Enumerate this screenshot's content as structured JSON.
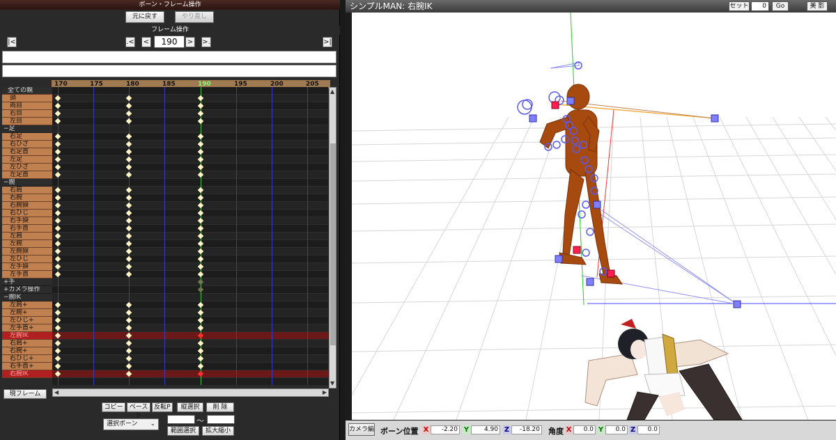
{
  "left_panel": {
    "bone_frame_header": "ボーン・フレーム操作",
    "undo_label": "元に戻す",
    "redo_label": "やり直し",
    "frame_ops_header": "フレーム操作",
    "nav": {
      "first": "|<",
      "prev_key": ".<",
      "prev": "<",
      "next": ">",
      "next_key": ">.",
      "last": ">|"
    },
    "current_frame": "190",
    "ruler": [
      "170",
      "175",
      "180",
      "185",
      "190",
      "195",
      "200",
      "205"
    ],
    "bones": [
      {
        "label": "全ての親",
        "kind": "top"
      },
      {
        "label": "頭",
        "kind": "bone"
      },
      {
        "label": "両目",
        "kind": "bone"
      },
      {
        "label": "右目",
        "kind": "bone"
      },
      {
        "label": "左目",
        "kind": "bone"
      },
      {
        "label": "−足",
        "kind": "group"
      },
      {
        "label": "右足",
        "kind": "bone"
      },
      {
        "label": "右ひざ",
        "kind": "bone"
      },
      {
        "label": "右足首",
        "kind": "bone"
      },
      {
        "label": "左足",
        "kind": "bone"
      },
      {
        "label": "左ひざ",
        "kind": "bone"
      },
      {
        "label": "左足首",
        "kind": "bone"
      },
      {
        "label": "−腕",
        "kind": "group"
      },
      {
        "label": "右肩",
        "kind": "bone"
      },
      {
        "label": "右腕",
        "kind": "bone"
      },
      {
        "label": "右腕捩",
        "kind": "bone"
      },
      {
        "label": "右ひじ",
        "kind": "bone"
      },
      {
        "label": "右手捩",
        "kind": "bone"
      },
      {
        "label": "右手首",
        "kind": "bone"
      },
      {
        "label": "左肩",
        "kind": "bone"
      },
      {
        "label": "左腕",
        "kind": "bone"
      },
      {
        "label": "左腕捩",
        "kind": "bone"
      },
      {
        "label": "左ひじ",
        "kind": "bone"
      },
      {
        "label": "左手捩",
        "kind": "bone"
      },
      {
        "label": "左手首",
        "kind": "bone"
      },
      {
        "label": "+手",
        "kind": "group"
      },
      {
        "label": "+カメラ操作",
        "kind": "group"
      },
      {
        "label": "−腕IK",
        "kind": "group"
      },
      {
        "label": "左肩+",
        "kind": "bone"
      },
      {
        "label": "左腕+",
        "kind": "bone"
      },
      {
        "label": "左ひじ+",
        "kind": "bone"
      },
      {
        "label": "左手首+",
        "kind": "bone"
      },
      {
        "label": "左腕IK",
        "kind": "bone",
        "selected": true
      },
      {
        "label": "右肩+",
        "kind": "bone"
      },
      {
        "label": "右腕+",
        "kind": "bone"
      },
      {
        "label": "右ひじ+",
        "kind": "bone"
      },
      {
        "label": "右手首+",
        "kind": "bone"
      },
      {
        "label": "右腕IK",
        "kind": "bone",
        "selected": true
      }
    ],
    "current_frame_label": "現フレーム",
    "copy_label": "コピー",
    "paste_label": "ペースト",
    "reverse_paste_label": "反転P",
    "vertical_select_label": "縦選択",
    "delete_label": "削 除",
    "select_dropdown": "選択ボーン",
    "range_tilde": "〜",
    "range_select_label": "範囲選択",
    "scale_label": "拡大縮小"
  },
  "viewport": {
    "title": "シンプルMAN: 右腕IK",
    "set_label": "セット",
    "frame_value": "0",
    "go_label": "Go",
    "beauty_label": "美 影"
  },
  "status": {
    "camera_edit_label": "カメラ編",
    "bone_position_label": "ボーン位置",
    "pos_x": "-2.20",
    "pos_y": "4.90",
    "pos_z": "-18.20",
    "angle_label": "角度",
    "rot_x": "0.0",
    "rot_y": "0.0",
    "rot_z": "0.0",
    "axis_x": "X",
    "axis_y": "Y",
    "axis_z": "Z"
  }
}
